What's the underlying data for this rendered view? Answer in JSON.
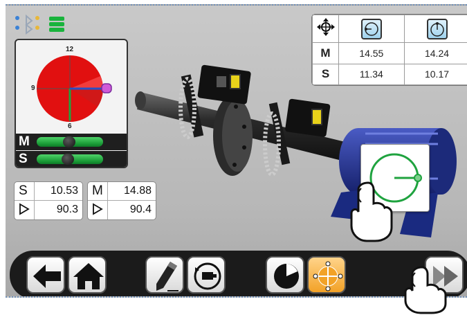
{
  "clock": {
    "label_12": "12",
    "label_9": "9",
    "label_6": "6"
  },
  "levels": {
    "m_label": "M",
    "s_label": "S"
  },
  "values_table": {
    "icons": [
      "move-icon",
      "horizontal-view-icon",
      "vertical-view-icon"
    ],
    "rows": [
      {
        "label": "M",
        "col1": "14.55",
        "col2": "14.24"
      },
      {
        "label": "S",
        "col1": "11.34",
        "col2": "10.17"
      }
    ]
  },
  "readout_s": {
    "key": "S",
    "value": "10.53",
    "angle": "90.3"
  },
  "readout_m": {
    "key": "M",
    "value": "14.88",
    "angle": "90.4"
  },
  "colors": {
    "accent_green": "#1fa33f",
    "red_sector": "#e01010",
    "toolbar": "#1b1b1b",
    "orange": "#f2a227"
  }
}
